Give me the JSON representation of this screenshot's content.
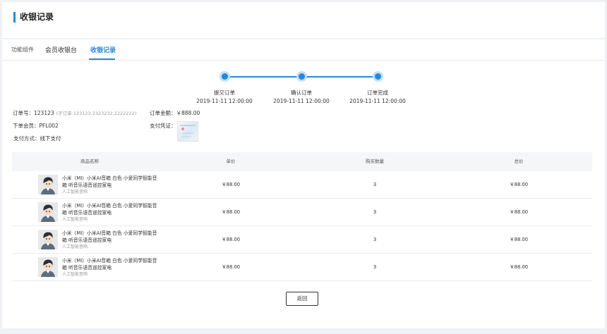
{
  "page": {
    "title": "收银记录"
  },
  "tabs": [
    {
      "label": "功能组件"
    },
    {
      "label": "会员收银台"
    },
    {
      "label": "收银记录"
    }
  ],
  "steps": [
    {
      "label": "提交订单",
      "time": "2019-11-11  12:00:00"
    },
    {
      "label": "确认订单",
      "time": "2019-11-11  12:00:00"
    },
    {
      "label": "订单完成",
      "time": "2019-11-11  12:00:00"
    }
  ],
  "order": {
    "number": "订单号：123123",
    "sub_orders": "(子订单:123123,2323232,2222222)",
    "member": "下单会员：PFL002",
    "pay_method": "支付方式：线下支付",
    "amount": "订单金额：￥888.00",
    "voucher_label": "支付凭证："
  },
  "table": {
    "headers": [
      "商品名称",
      "单价",
      "购买数量",
      "总价"
    ],
    "rows": [
      {
        "name": "小米（MI）小米AI音箱 白色 小爱同学智能音箱 听音乐语音遥控家电",
        "sub": "人工智能音响",
        "price": "￥88.00",
        "qty": "3",
        "total": "￥88.00"
      },
      {
        "name": "小米（MI）小米AI音箱 白色 小爱同学智能音箱 听音乐语音遥控家电",
        "sub": "人工智能音响",
        "price": "￥88.00",
        "qty": "3",
        "total": "￥88.00"
      },
      {
        "name": "小米（MI）小米AI音箱 白色 小爱同学智能音箱 听音乐语音遥控家电",
        "sub": "人工智能音响",
        "price": "￥88.00",
        "qty": "3",
        "total": "￥88.00"
      },
      {
        "name": "小米（MI）小米AI音箱 白色 小爱同学智能音箱 听音乐语音遥控家电",
        "sub": "人工智能音响",
        "price": "￥88.00",
        "qty": "3",
        "total": "￥88.00"
      }
    ]
  },
  "actions": {
    "back_label": "返回"
  },
  "colors": {
    "accent": "#1e8ae8",
    "step_halo": "#bfe0fb",
    "background": "#eef2f6"
  }
}
